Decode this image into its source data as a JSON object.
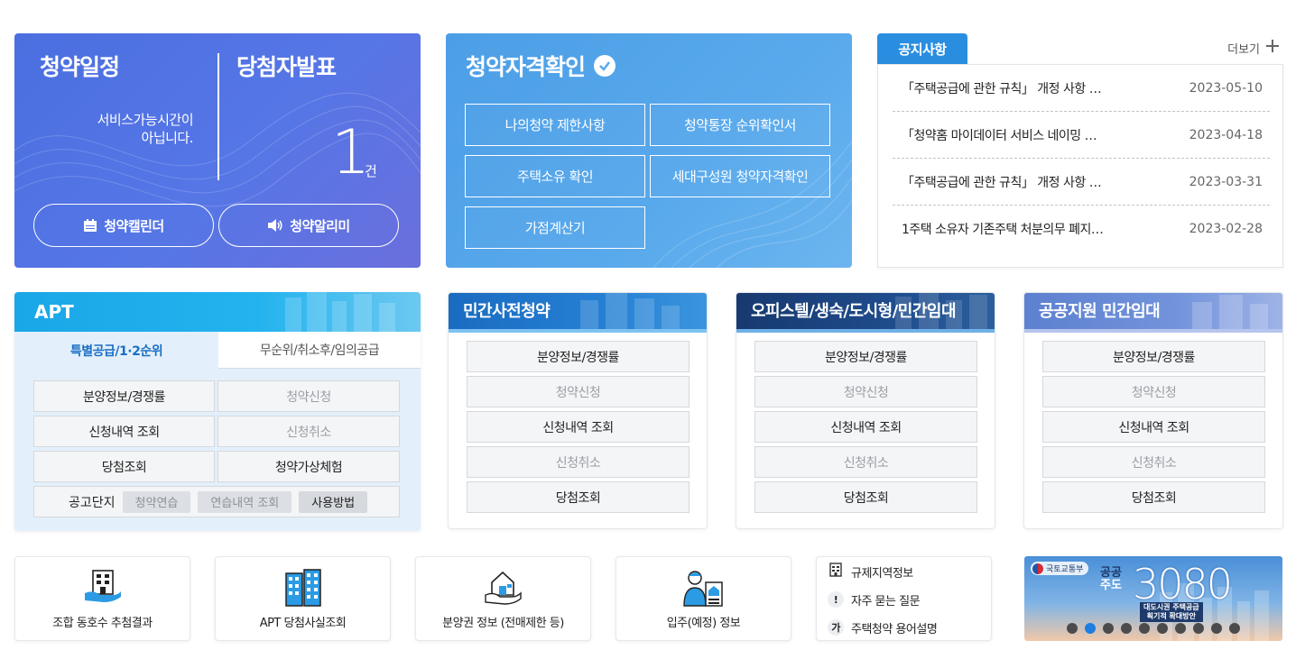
{
  "schedule": {
    "title": "청약일정",
    "message_line1": "서비스가능시간이",
    "message_line2": "아닙니다.",
    "calendar_button": "청약캘린더",
    "alert_button": "청약알리미"
  },
  "results": {
    "title": "당첨자발표",
    "count": "1",
    "unit": "건"
  },
  "qualification": {
    "title": "청약자격확인",
    "buttons": [
      "나의청약 제한사항",
      "청약통장 순위확인서",
      "주택소유 확인",
      "세대구성원 청약자격확인",
      "가점계산기"
    ]
  },
  "notice": {
    "tab": "공지사항",
    "more": "더보기",
    "items": [
      {
        "title": "「주택공급에 관한 규칙」 개정 사항 …",
        "date": "2023-05-10"
      },
      {
        "title": "「청약홈 마이데이터 서비스 네이밍 …",
        "date": "2023-04-18"
      },
      {
        "title": "「주택공급에 관한 규칙」 개정 사항 …",
        "date": "2023-03-31"
      },
      {
        "title": "1주택 소유자 기존주택 처분의무 폐지…",
        "date": "2023-02-28"
      }
    ]
  },
  "apt": {
    "title": "APT",
    "tab_active": "특별공급/1·2순위",
    "tab_inactive": "무순위/취소후/임의공급",
    "buttons": [
      "분양정보/경쟁률",
      "청약신청",
      "신청내역 조회",
      "신청취소",
      "당첨조회",
      "청약가상체험"
    ],
    "bottom_label": "공고단지",
    "chips": [
      "청약연습",
      "연습내역 조회",
      "사용방법"
    ]
  },
  "private_pre": {
    "title": "민간사전청약",
    "buttons": [
      "분양정보/경쟁률",
      "청약신청",
      "신청내역 조회",
      "신청취소",
      "당첨조회"
    ]
  },
  "officetel": {
    "title": "오피스텔/생숙/도시형/민간임대",
    "buttons": [
      "분양정보/경쟁률",
      "청약신청",
      "신청내역 조회",
      "신청취소",
      "당첨조회"
    ]
  },
  "public_rental": {
    "title": "공공지원 민간임대",
    "buttons": [
      "분양정보/경쟁률",
      "청약신청",
      "신청내역 조회",
      "신청취소",
      "당첨조회"
    ]
  },
  "quick": [
    {
      "label": "조합 동호수 추첨결과",
      "icon": "building-hand-icon"
    },
    {
      "label": "APT 당첨사실조회",
      "icon": "apartment-icon"
    },
    {
      "label": "분양권 정보 (전매제한 등)",
      "icon": "house-hand-icon"
    },
    {
      "label": "입주(예정) 정보",
      "icon": "person-document-icon"
    }
  ],
  "links": [
    {
      "label": "규제지역정보",
      "badge": ""
    },
    {
      "label": "자주 묻는 질문",
      "badge": "!"
    },
    {
      "label": "주택청약 용어설명",
      "badge": "가"
    }
  ],
  "banner": {
    "ministry": "국토교통부",
    "headline1": "공공",
    "headline2": "주도",
    "number": "3080",
    "sub1": "대도시권 주택공급",
    "sub2": "획기적 확대방안",
    "dot_count": 10,
    "active_dot": 2
  },
  "colors": {
    "schedule_bg": "#5676e6",
    "qualification_bg": "#58a9ec",
    "notice_tab": "#2a8ee0",
    "apt_head": "#1aa7e8",
    "private_head": "#1e74c8",
    "officetel_head": "#1a3f7c",
    "public_head": "#6f8fd6"
  }
}
